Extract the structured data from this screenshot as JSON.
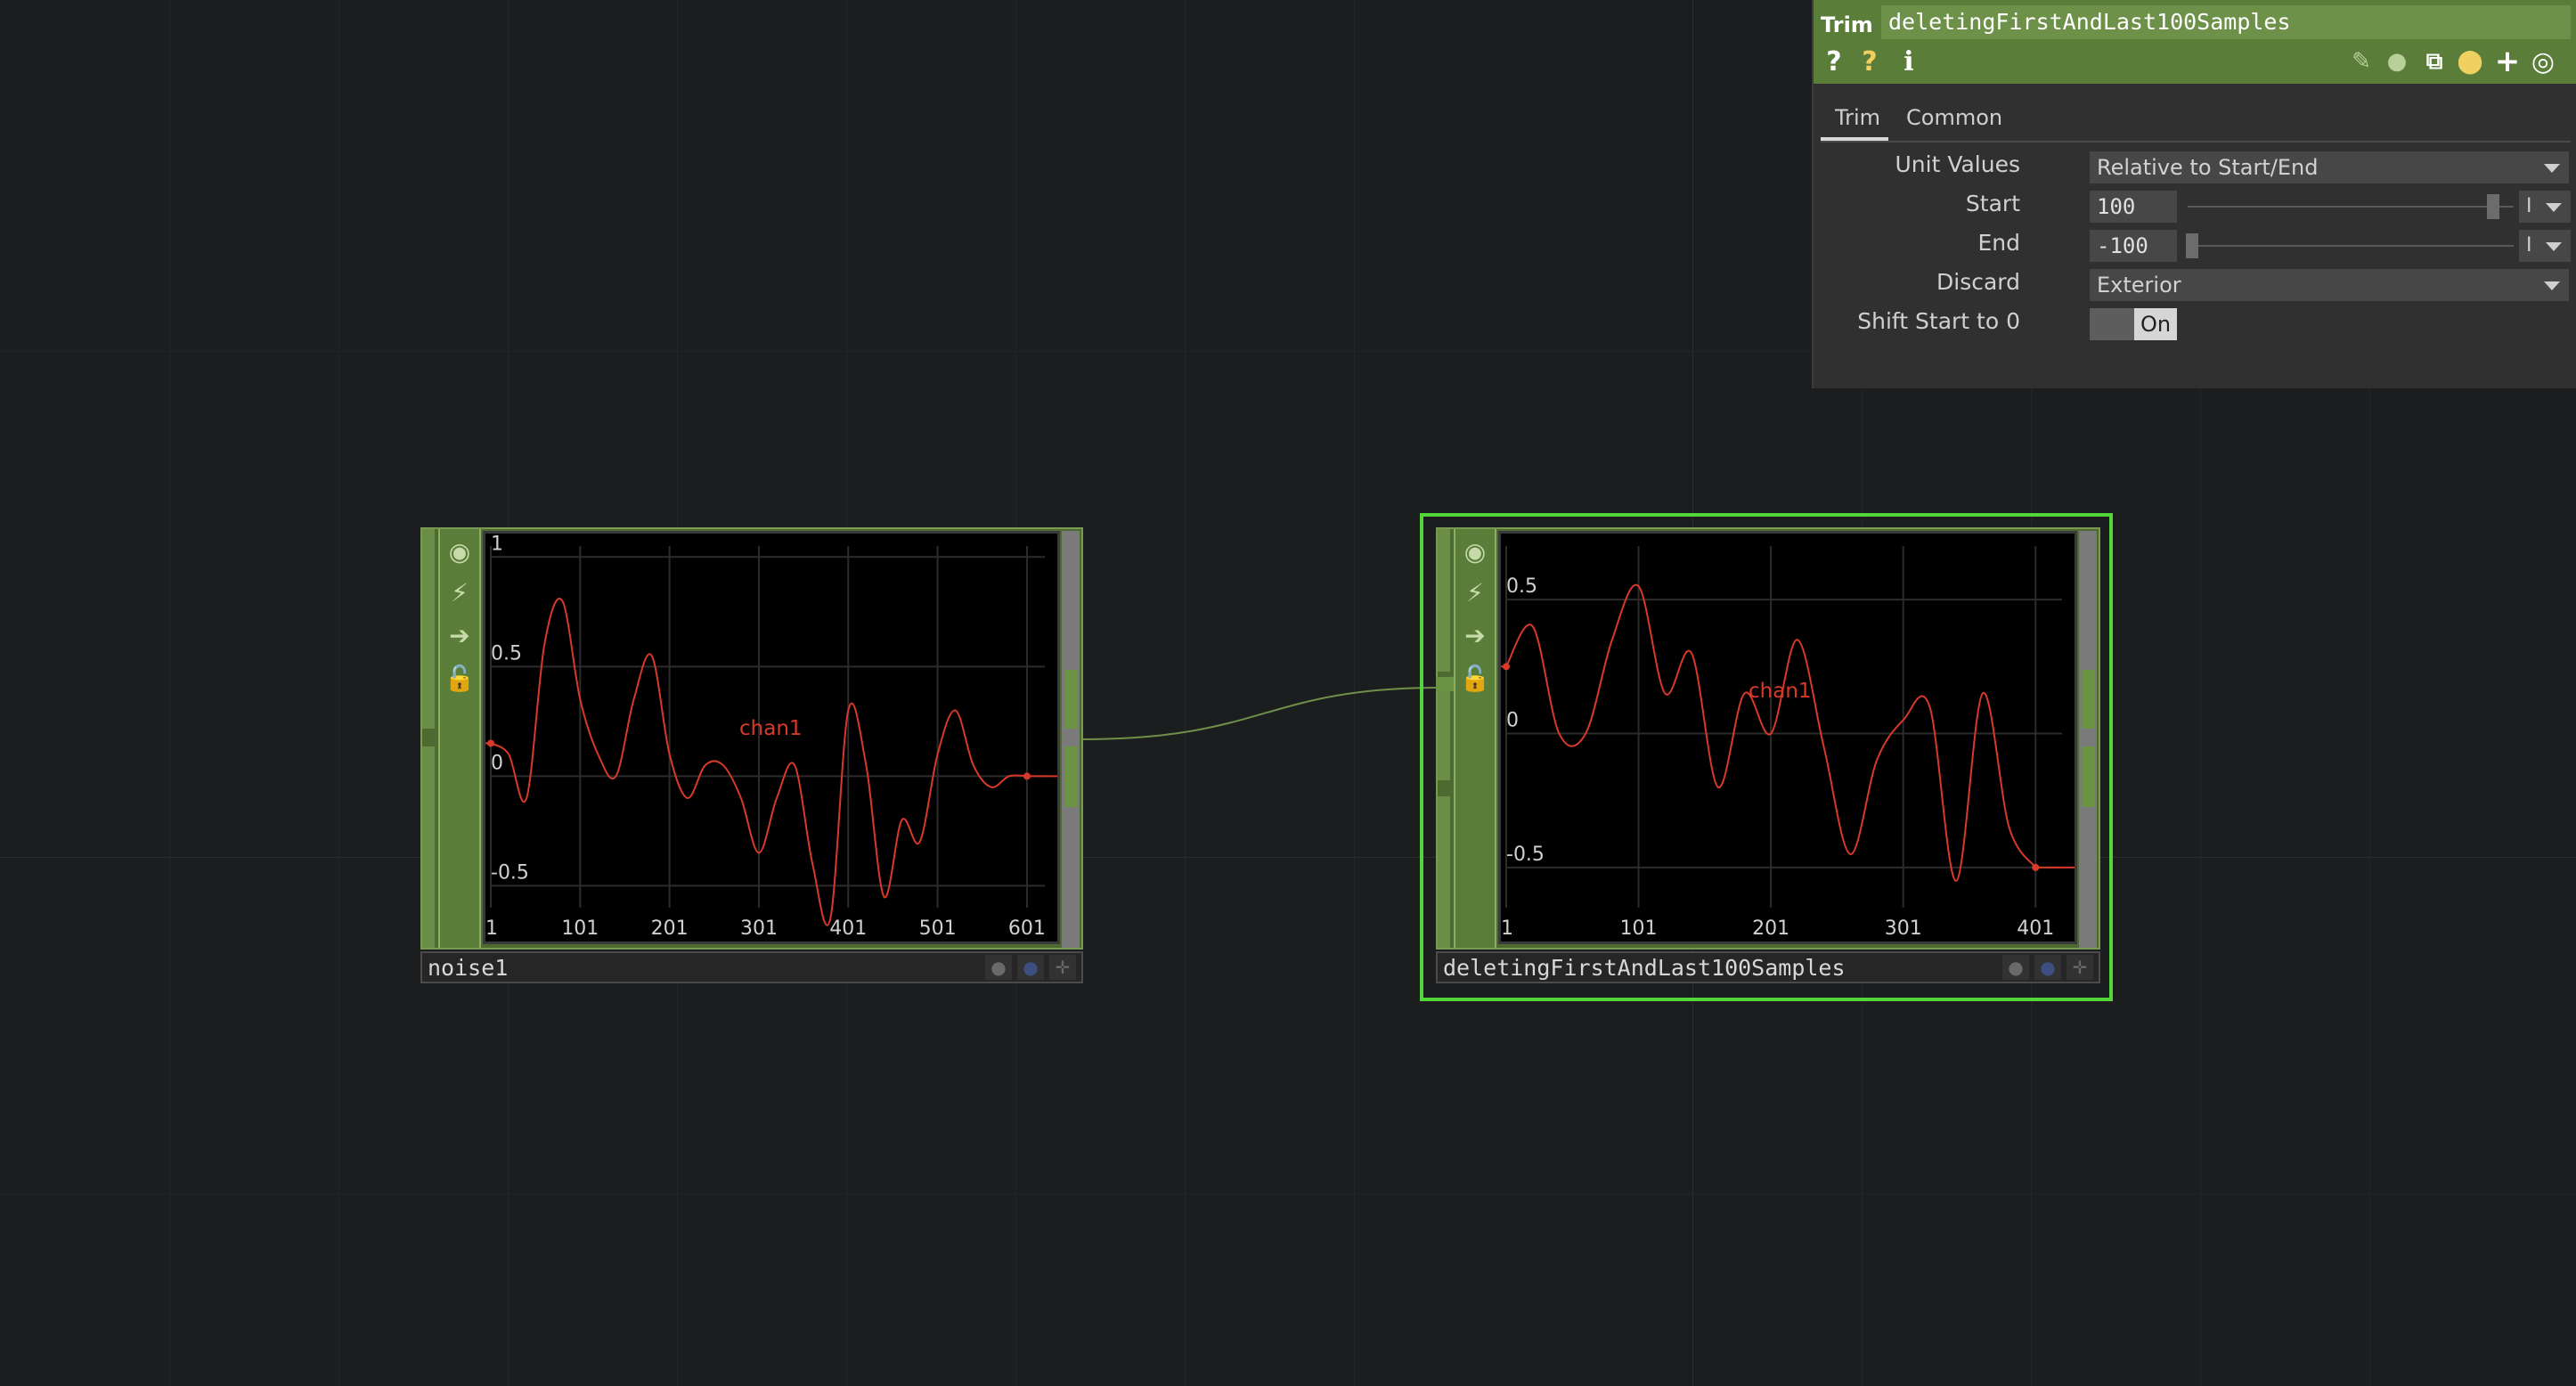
{
  "params": {
    "op_type": "Trim",
    "op_name": "deletingFirstAndLast100Samples",
    "header_icons": [
      "help-icon",
      "python-help-icon",
      "info-icon",
      "edit-icon",
      "comment-icon",
      "clone-icon",
      "python-icon",
      "add-icon",
      "target-icon"
    ],
    "tabs": [
      {
        "label": "Trim",
        "active": true
      },
      {
        "label": "Common",
        "active": false
      }
    ],
    "unit_values": {
      "label": "Unit Values",
      "value": "Relative to Start/End"
    },
    "start": {
      "label": "Start",
      "value": "100",
      "unit": "I",
      "slider": 0.98
    },
    "end": {
      "label": "End",
      "value": "-100",
      "unit": "I",
      "slider": 0.02
    },
    "discard": {
      "label": "Discard",
      "value": "Exterior"
    },
    "shift_start": {
      "label": "Shift Start to 0",
      "value": "On"
    }
  },
  "nodes": {
    "noise1": {
      "name": "noise1",
      "y_ticks": [
        {
          "v": 1,
          "t": "1"
        },
        {
          "v": 0.5,
          "t": "0.5"
        },
        {
          "v": 0,
          "t": "0"
        },
        {
          "v": -0.5,
          "t": "-0.5"
        }
      ],
      "x_ticks": [
        "1",
        "101",
        "201",
        "301",
        "401",
        "501",
        "601"
      ],
      "channel": "chan1"
    },
    "trim": {
      "name": "deletingFirstAndLast100Samples",
      "y_ticks": [
        {
          "v": 0.5,
          "t": "0.5"
        },
        {
          "v": 0,
          "t": "0"
        },
        {
          "v": -0.5,
          "t": "-0.5"
        }
      ],
      "x_ticks": [
        "1",
        "101",
        "201",
        "301",
        "401"
      ],
      "channel": "chan1"
    }
  },
  "chart_data": [
    {
      "type": "line",
      "title": "",
      "series": [
        {
          "name": "chan1",
          "color": "#d9392a",
          "x": [
            1,
            21,
            41,
            61,
            81,
            101,
            121,
            141,
            161,
            181,
            201,
            221,
            241,
            261,
            281,
            301,
            321,
            341,
            361,
            381,
            401,
            421,
            441,
            461,
            481,
            501,
            521,
            541,
            561,
            581,
            601
          ],
          "y": [
            0.15,
            0.1,
            -0.1,
            0.6,
            0.8,
            0.35,
            0.1,
            0.0,
            0.35,
            0.55,
            0.1,
            -0.1,
            0.05,
            0.05,
            -0.1,
            -0.35,
            -0.1,
            0.05,
            -0.4,
            -0.65,
            0.3,
            0.05,
            -0.55,
            -0.2,
            -0.3,
            0.1,
            0.3,
            0.05,
            -0.05,
            0.0,
            0.0
          ]
        }
      ],
      "xlim": [
        1,
        621
      ],
      "ylim": [
        -0.6,
        1.05
      ],
      "grid": true
    },
    {
      "type": "line",
      "title": "",
      "series": [
        {
          "name": "chan1",
          "color": "#d9392a",
          "x": [
            1,
            21,
            41,
            61,
            81,
            101,
            121,
            141,
            161,
            181,
            201,
            221,
            241,
            261,
            281,
            301,
            321,
            341,
            361,
            381,
            401
          ],
          "y": [
            0.25,
            0.4,
            0.0,
            0.0,
            0.35,
            0.55,
            0.15,
            0.3,
            -0.2,
            0.15,
            0.0,
            0.35,
            -0.05,
            -0.45,
            -0.1,
            0.05,
            0.1,
            -0.55,
            0.15,
            -0.35,
            -0.5
          ]
        }
      ],
      "xlim": [
        1,
        421
      ],
      "ylim": [
        -0.65,
        0.7
      ],
      "grid": true
    }
  ]
}
